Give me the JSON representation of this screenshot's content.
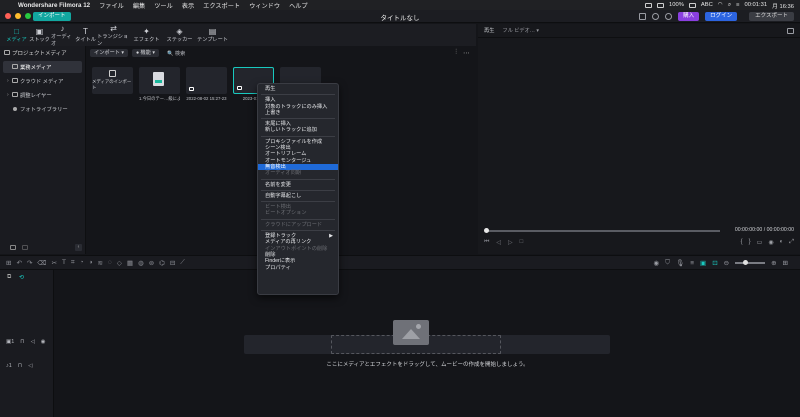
{
  "menubar": {
    "app_name": "Wondershare Filmora 12",
    "items": [
      "ファイル",
      "編集",
      "ツール",
      "表示",
      "エクスポート",
      "ウィンドウ",
      "ヘルプ"
    ],
    "battery": "100%",
    "input": "ABC",
    "timer": "00:01:31",
    "clock": "月 16:36"
  },
  "titlebar": {
    "import_label": "インポート",
    "title": "タイトルなし",
    "buy_label": "購入",
    "login_label": "ログイン",
    "export_label": "エクスポート"
  },
  "media_tabs": [
    {
      "label": "メディア",
      "icon": "□"
    },
    {
      "label": "ストック",
      "icon": "▣"
    },
    {
      "label": "オーディオ",
      "icon": "♪"
    },
    {
      "label": "タイトル",
      "icon": "T"
    },
    {
      "label": "トランジション",
      "icon": "⇄"
    },
    {
      "label": "エフェクト",
      "icon": "✦"
    },
    {
      "label": "ステッカー",
      "icon": "◈"
    },
    {
      "label": "テンプレート",
      "icon": "▤"
    }
  ],
  "sidebar": {
    "header": "プロジェクトメディア",
    "items": [
      {
        "label": "業務メディア",
        "selected": true
      },
      {
        "label": "クラウド メディア",
        "selected": false
      },
      {
        "label": "調整レイヤー",
        "selected": false
      },
      {
        "label": "フォトライブラリー",
        "selected": false
      }
    ]
  },
  "content": {
    "import_dropdown": "インポート ▾",
    "filter_dropdown": "● 機能 ▾",
    "search_placeholder": "🔍 検索",
    "thumbnails": [
      {
        "caption": "",
        "label": "メディアのインポート"
      },
      {
        "caption": "1.今日のテー…級によく使う…"
      },
      {
        "caption": "2022-08-02 15:27-23"
      },
      {
        "caption": "2023-01-…"
      },
      {
        "caption": ""
      }
    ]
  },
  "preview": {
    "label": "再生",
    "quality": "フル ビデオ…",
    "time_current": "00:00:00:00",
    "time_sep": "/",
    "time_total": "00:00:00:00"
  },
  "context_menu": {
    "items": [
      {
        "label": "再生",
        "state": "normal"
      },
      {
        "sep": true
      },
      {
        "label": "挿入",
        "state": "normal"
      },
      {
        "label": "対象のトラックにのみ挿入",
        "state": "normal"
      },
      {
        "label": "上書き",
        "state": "normal"
      },
      {
        "sep": true
      },
      {
        "label": "末尾に挿入",
        "state": "normal"
      },
      {
        "label": "新しいトラックに追加",
        "state": "normal"
      },
      {
        "sep": true
      },
      {
        "label": "プロキシファイルを作成",
        "state": "normal"
      },
      {
        "label": "シーン検出",
        "state": "normal"
      },
      {
        "label": "オートリフレーム",
        "state": "normal"
      },
      {
        "label": "オートモンタージュ",
        "state": "normal"
      },
      {
        "label": "無音検出",
        "state": "highlighted"
      },
      {
        "label": "オーディオ同期",
        "state": "disabled"
      },
      {
        "sep": true
      },
      {
        "label": "名前を変更",
        "state": "normal"
      },
      {
        "sep": true
      },
      {
        "label": "自動字幕起こし",
        "state": "normal"
      },
      {
        "sep": true
      },
      {
        "label": "ビート検出",
        "state": "disabled"
      },
      {
        "label": "ビートオプション",
        "state": "disabled"
      },
      {
        "sep": true
      },
      {
        "label": "クラウドにアップロード",
        "state": "disabled"
      },
      {
        "sep": true
      },
      {
        "label": "登録トラック",
        "state": "normal",
        "submenu": true
      },
      {
        "label": "メディアの再リンク",
        "state": "normal"
      },
      {
        "label": "インアウトポイントの削除",
        "state": "disabled"
      },
      {
        "label": "削除",
        "state": "normal"
      },
      {
        "label": "Finderに表示",
        "state": "normal"
      },
      {
        "label": "プロパティ",
        "state": "normal"
      }
    ]
  },
  "timeline": {
    "drop_text": "ここにメディアとエフェクトをドラッグして、ムービーの作成を開始しましょう。",
    "video_track": "▣1",
    "audio_track": "♪1"
  },
  "colors": {
    "accent": "#19c9bf",
    "highlight": "#1f6ad8",
    "buy": "#8a3fe0",
    "login": "#2c64e0"
  }
}
